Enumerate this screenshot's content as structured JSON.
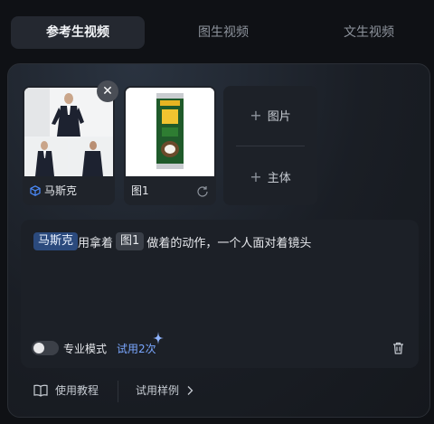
{
  "tabs": [
    {
      "label": "参考生视频",
      "active": true
    },
    {
      "label": "图生视频",
      "active": false
    },
    {
      "label": "文生视频",
      "active": false
    }
  ],
  "subject_card": {
    "label": "马斯克",
    "icon": "cube-icon"
  },
  "image_card": {
    "label": "图1",
    "icon": "retry-icon"
  },
  "add_card": {
    "image_label": "图片",
    "subject_label": "主体"
  },
  "prompt": {
    "subject_chip": "马斯克",
    "text1": "用拿着",
    "image_chip": "图1",
    "text2": "做着的动作，一个人面对着镜头"
  },
  "mode": {
    "label": "专业模式",
    "enabled": false,
    "trial_text": "试用2次"
  },
  "footer": {
    "tutorial_label": "使用教程",
    "examples_label": "试用样例"
  },
  "colors": {
    "accent": "#2b4a7d",
    "trial": "#7aa7ff",
    "background": "#0f1115"
  }
}
